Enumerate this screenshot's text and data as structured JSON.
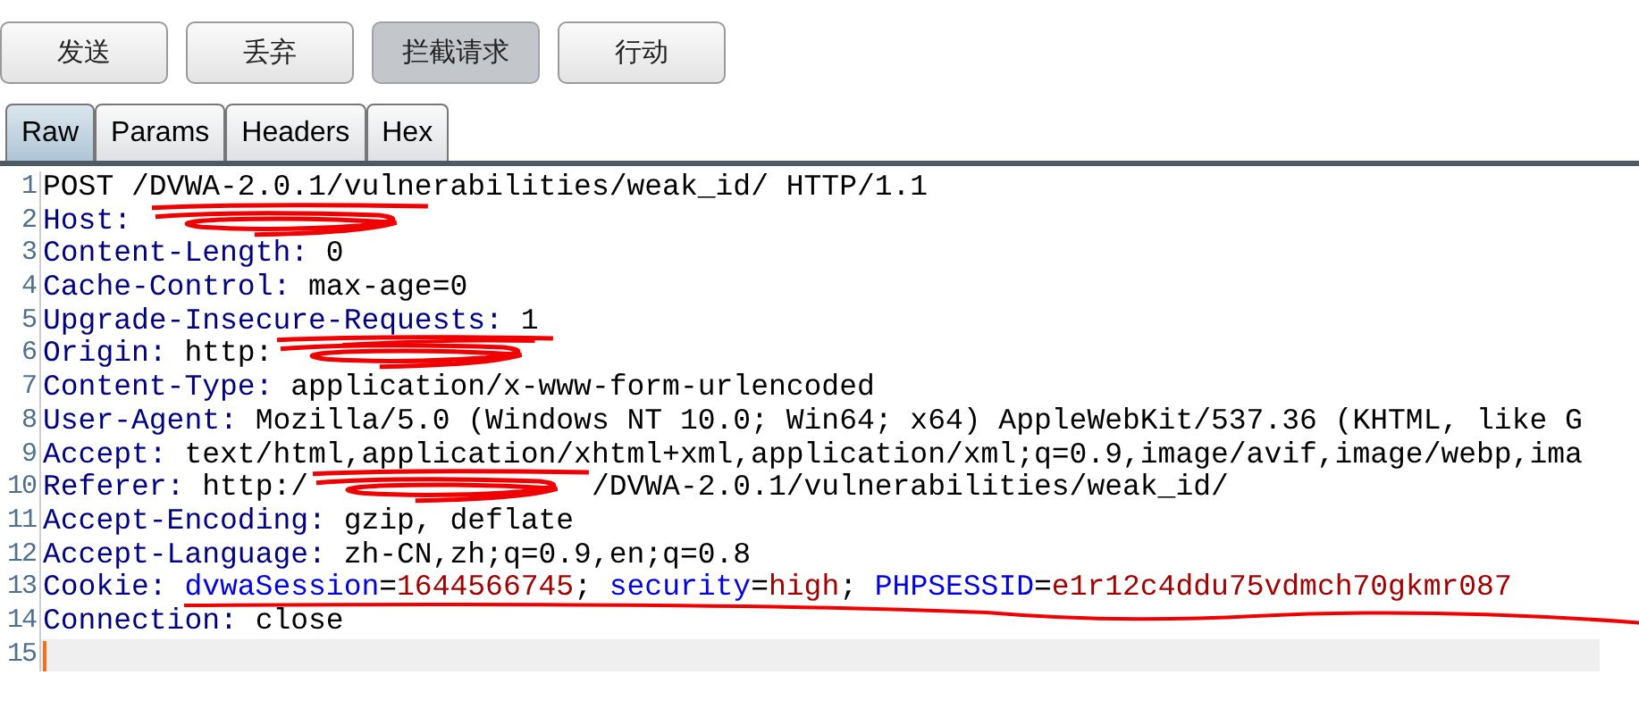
{
  "toolbar": {
    "buttons": [
      {
        "label": "发送",
        "selected": false
      },
      {
        "label": "丢弃",
        "selected": false
      },
      {
        "label": "拦截请求",
        "selected": true
      },
      {
        "label": "行动",
        "selected": false
      }
    ]
  },
  "tabs": [
    {
      "label": "Raw",
      "selected": true
    },
    {
      "label": "Params",
      "selected": false
    },
    {
      "label": "Headers",
      "selected": false
    },
    {
      "label": "Hex",
      "selected": false
    }
  ],
  "editor": {
    "lines": [
      {
        "number": "1",
        "segments": [
          {
            "kind": "plain",
            "text": "POST /DVWA-2.0.1/vulnerabilities/weak_id/ HTTP/1.1"
          }
        ]
      },
      {
        "number": "2",
        "segments": [
          {
            "kind": "header",
            "text": "Host:"
          },
          {
            "kind": "redacted"
          }
        ]
      },
      {
        "number": "3",
        "segments": [
          {
            "kind": "header",
            "text": "Content-Length:"
          },
          {
            "kind": "plain",
            "text": "0"
          }
        ]
      },
      {
        "number": "4",
        "segments": [
          {
            "kind": "header",
            "text": "Cache-Control:"
          },
          {
            "kind": "plain",
            "text": "max-age=0"
          }
        ]
      },
      {
        "number": "5",
        "segments": [
          {
            "kind": "header",
            "text": "Upgrade-Insecure-"
          },
          {
            "kind": "header",
            "text": "Requests:",
            "underlined": true
          },
          {
            "kind": "plain",
            "text": "1"
          }
        ]
      },
      {
        "number": "6",
        "segments": [
          {
            "kind": "header",
            "text": "Origin:"
          },
          {
            "kind": "plain",
            "text": "http:"
          },
          {
            "kind": "redacted"
          }
        ]
      },
      {
        "number": "7",
        "segments": [
          {
            "kind": "header",
            "text": "Content-Type:"
          },
          {
            "kind": "plain",
            "text": "application/x-www-form-urlencoded"
          }
        ]
      },
      {
        "number": "8",
        "segments": [
          {
            "kind": "header",
            "text": "User-Agent:"
          },
          {
            "kind": "plain",
            "text": "Mozilla/5.0 (Windows NT 10.0; Win64; x64) AppleWebKit/537.36 (KHTML, like G"
          }
        ]
      },
      {
        "number": "9",
        "segments": [
          {
            "kind": "header",
            "text": "Accept:"
          },
          {
            "kind": "plain",
            "text": "text/html,application/xhtml+xml,application/xml;q=0.9,image/avif,image/webp,ima"
          }
        ]
      },
      {
        "number": "10",
        "segments": [
          {
            "kind": "header",
            "text": "Referer:"
          },
          {
            "kind": "plain",
            "text": "http:/"
          },
          {
            "kind": "redacted"
          },
          {
            "kind": "plain",
            "text": "/DVWA-2.0.1/vulnerabilities/weak_id/"
          }
        ]
      },
      {
        "number": "11",
        "segments": [
          {
            "kind": "header",
            "text": "Accept-Encoding:"
          },
          {
            "kind": "plain",
            "text": "gzip, deflate"
          }
        ]
      },
      {
        "number": "12",
        "segments": [
          {
            "kind": "header",
            "text": "Accept-Language:"
          },
          {
            "kind": "plain",
            "text": "zh-CN,zh;q=0.9,en;q=0.8"
          }
        ]
      },
      {
        "number": "13",
        "underline_to_edge": true,
        "segments": [
          {
            "kind": "header",
            "text": "Cookie:"
          },
          {
            "kind": "param-name",
            "text": "dvwaSession",
            "underlined": true
          },
          {
            "kind": "plain",
            "text": "="
          },
          {
            "kind": "param-value",
            "text": "1644566745"
          },
          {
            "kind": "plain",
            "text": ";"
          },
          {
            "kind": "param-name",
            "text": "security"
          },
          {
            "kind": "plain",
            "text": "="
          },
          {
            "kind": "param-value",
            "text": "high"
          },
          {
            "kind": "plain",
            "text": ";"
          },
          {
            "kind": "param-name",
            "text": "PHPSESSID"
          },
          {
            "kind": "plain",
            "text": "="
          },
          {
            "kind": "param-value",
            "text": "e1r12c4ddu75vdmch70gkmr087"
          }
        ]
      },
      {
        "number": "14",
        "segments": [
          {
            "kind": "header",
            "text": "Connection:"
          },
          {
            "kind": "plain",
            "text": "close"
          }
        ]
      },
      {
        "number": "15",
        "current": true
      }
    ]
  }
}
